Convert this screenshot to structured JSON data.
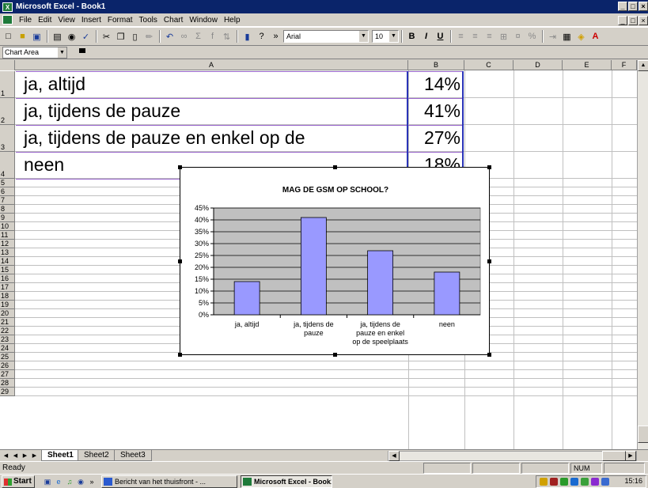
{
  "window": {
    "title": "Microsoft Excel - Book1",
    "controls": [
      "_",
      "□",
      "×"
    ]
  },
  "menu": {
    "items": [
      "File",
      "Edit",
      "View",
      "Insert",
      "Format",
      "Tools",
      "Chart",
      "Window",
      "Help"
    ]
  },
  "toolbar": {
    "font_name": "Arial",
    "font_size": "10",
    "bold": "B",
    "italic": "I",
    "underline": "U",
    "more": "»"
  },
  "name_box": {
    "value": "Chart Area"
  },
  "columns": [
    "A",
    "B",
    "C",
    "D",
    "E",
    "F"
  ],
  "rows": [
    "1",
    "2",
    "3",
    "4",
    "5",
    "6",
    "7",
    "8",
    "9",
    "10",
    "11",
    "12",
    "13",
    "14",
    "15",
    "16",
    "17",
    "18",
    "19",
    "20",
    "21",
    "22",
    "23",
    "24",
    "25",
    "26",
    "27",
    "28",
    "29"
  ],
  "cells": [
    {
      "a": "ja, altijd",
      "b": "14%"
    },
    {
      "a": "ja, tijdens de pauze",
      "b": "41%"
    },
    {
      "a": "ja, tijdens de pauze en enkel op de",
      "b": "27%"
    },
    {
      "a": "neen",
      "b": "18%"
    }
  ],
  "chart_data": {
    "type": "bar",
    "title": "MAG DE GSM OP SCHOOL?",
    "categories": [
      [
        "ja, altijd"
      ],
      [
        "ja, tijdens de",
        "pauze"
      ],
      [
        "ja, tijdens de",
        "pauze en enkel",
        "op de speelplaats"
      ],
      [
        "neen"
      ]
    ],
    "values": [
      14,
      41,
      27,
      18
    ],
    "ylim": [
      0,
      45
    ],
    "yticks": [
      "0%",
      "5%",
      "10%",
      "15%",
      "20%",
      "25%",
      "30%",
      "35%",
      "40%",
      "45%"
    ],
    "grid": true,
    "bar_color": "#9999ff",
    "plot_bg": "#c0c0c0"
  },
  "sheet_tabs": [
    "Sheet1",
    "Sheet2",
    "Sheet3"
  ],
  "status": {
    "text": "Ready",
    "num": "NUM"
  },
  "taskbar": {
    "start": "Start",
    "more": "»",
    "buttons": [
      {
        "label": "Bericht van het thuisfront - ..."
      },
      {
        "label": "Microsoft Excel - Book1"
      }
    ],
    "clock": "15:16"
  }
}
